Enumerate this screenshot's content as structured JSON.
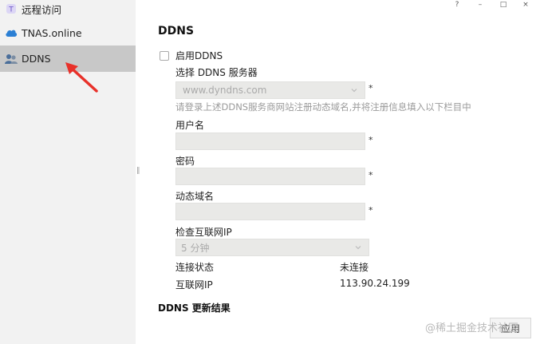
{
  "window_controls": {
    "help": "?",
    "minimize": "–",
    "maximize": "□",
    "close": "×"
  },
  "sidebar": {
    "items": [
      {
        "label": "远程访问",
        "icon": "remote-access-icon",
        "active": false
      },
      {
        "label": "TNAS.online",
        "icon": "cloud-icon",
        "active": false
      },
      {
        "label": "DDNS",
        "icon": "users-icon",
        "active": true
      }
    ]
  },
  "main": {
    "title": "DDNS",
    "enable_label": "启用DDNS",
    "server_label": "选择 DDNS 服务器",
    "server_value": "www.dyndns.com",
    "required_mark": "*",
    "hint": "请登录上述DDNS服务商网站注册动态域名,并将注册信息填入以下栏目中",
    "username_label": "用户名",
    "password_label": "密码",
    "domain_label": "动态域名",
    "check_ip_label": "检查互联网IP",
    "check_ip_value": "5 分钟",
    "status_label": "连接状态",
    "status_value": "未连接",
    "ip_label": "互联网IP",
    "ip_value": "113.90.24.199",
    "results_label": "DDNS 更新结果",
    "apply_label": "应用"
  },
  "watermark": "@稀土掘金技术社区",
  "colors": {
    "sidebar_bg": "#f2f2f2",
    "active_bg": "#c8c8c8",
    "field_bg": "#e9e9e7",
    "arrow": "#e8312a"
  }
}
